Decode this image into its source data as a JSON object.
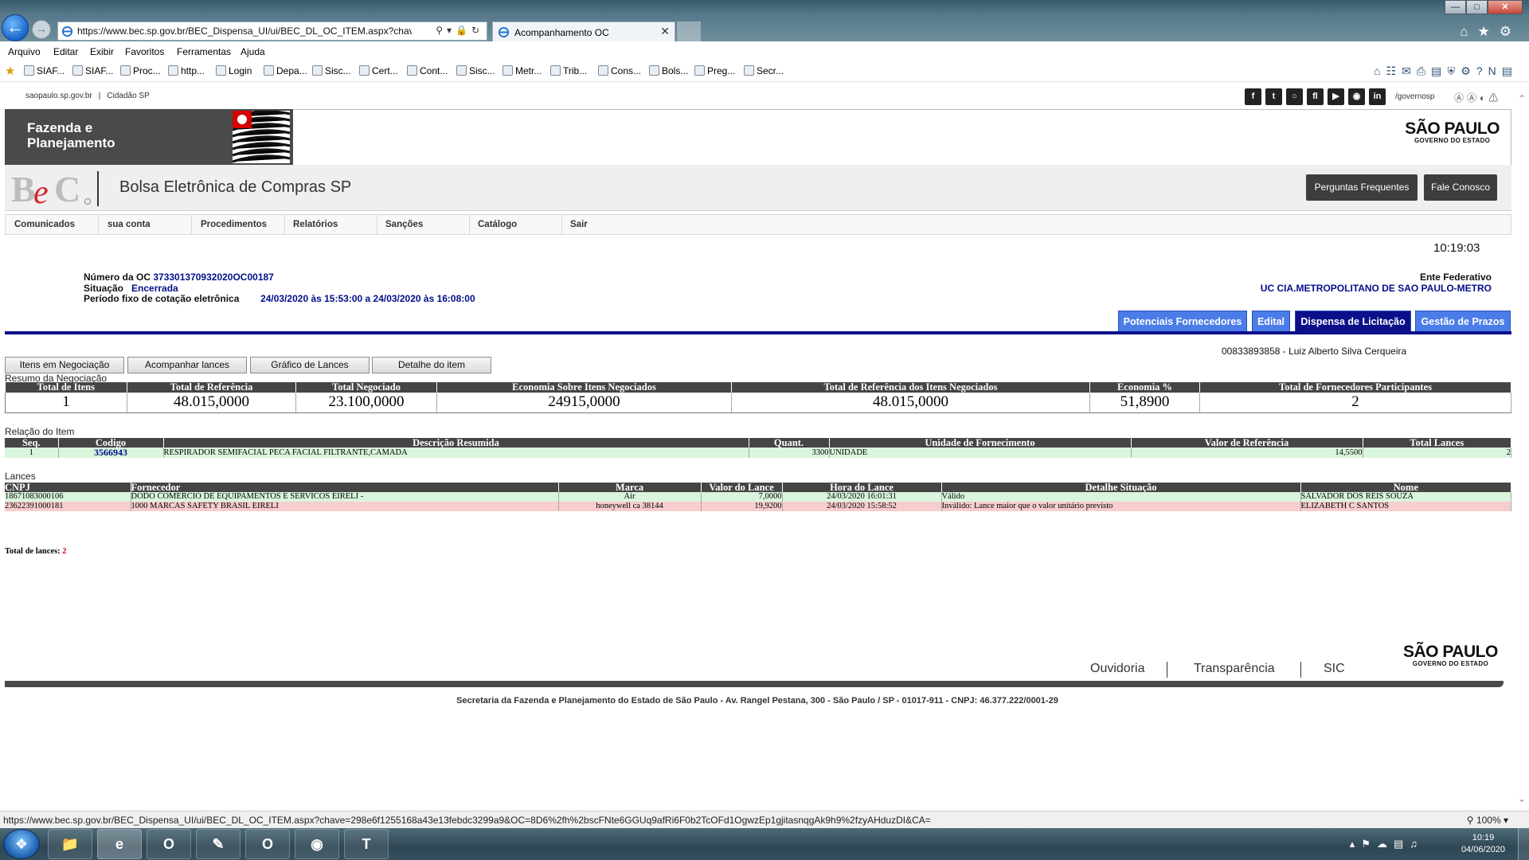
{
  "browser": {
    "url": "https://www.bec.sp.gov.br/BEC_Dispensa_UI/ui/BEC_DL_OC_ITEM.aspx?chave=298e6",
    "tab_title": "Acompanhamento OC",
    "menu": [
      "Arquivo",
      "Editar",
      "Exibir",
      "Favoritos",
      "Ferramentas",
      "Ajuda"
    ],
    "favorites": [
      "SIAF...",
      "SIAF...",
      "Proc...",
      "http...",
      "Login",
      "Depa...",
      "Sisc...",
      "Cert...",
      "Cont...",
      "Sisc...",
      "Metr...",
      "Trib...",
      "Cons...",
      "Bols...",
      "Preg...",
      "Secr..."
    ],
    "status_url": "https://www.bec.sp.gov.br/BEC_Dispensa_UI/ui/BEC_DL_OC_ITEM.aspx?chave=298e6f1255168a43e13febdc3299a9&OC=8D6%2fh%2bscFNte6GGUq9afRi6F0b2TcOFd1OgwzEp1gjitasnqgAk9h9%2fzyAHduzDI&CA=",
    "zoom": "100%"
  },
  "portal": {
    "link1": "saopaulo.sp.gov.br",
    "link2": "Cidadão SP",
    "social_icons": [
      "facebook-icon",
      "twitter-icon",
      "instagram-icon",
      "flickr-icon",
      "youtube-icon",
      "issuu-icon",
      "linkedin-icon"
    ],
    "social_handle": "/governosp",
    "dept": "Fazenda e Planejamento",
    "sp_logo_big": "SÃO PAULO",
    "sp_logo_small": "GOVERNO DO ESTADO"
  },
  "bec": {
    "title": "Bolsa Eletrônica de Compras SP",
    "btn_faq": "Perguntas Frequentes",
    "btn_contact": "Fale Conosco",
    "nav": [
      "Comunicados",
      "sua conta",
      "Procedimentos",
      "Relatórios",
      "Sanções",
      "Catálogo",
      "Sair"
    ],
    "clock": "10:19:03"
  },
  "oc": {
    "numero_label": "Número da OC",
    "numero": "373301370932020OC00187",
    "situacao_label": "Situação",
    "situacao": "Encerrada",
    "periodo_label": "Período fixo de cotação eletrônica",
    "periodo": "24/03/2020 às 15:53:00 a 24/03/2020 às 16:08:00",
    "ente_label": "Ente Federativo",
    "uc": "UC CIA.METROPOLITANO DE SAO PAULO-METRO"
  },
  "tabs": [
    "Potenciais Fornecedores",
    "Edital",
    "Dispensa de Licitação",
    "Gestão de Prazos"
  ],
  "actions": [
    "Itens em Negociação",
    "Acompanhar lances",
    "Gráfico de Lances",
    "Detalhe do item"
  ],
  "user": "00833893858 - Luiz Alberto Silva Cerqueira",
  "resumo": {
    "label": "Resumo da Negociação",
    "headers": [
      "Total de Itens",
      "Total de Referência",
      "Total Negociado",
      "Economia Sobre Itens Negociados",
      "Total de Referência dos Itens Negociados",
      "Economia %",
      "Total de Fornecedores Participantes"
    ],
    "values": [
      "1",
      "48.015,0000",
      "23.100,0000",
      "24915,0000",
      "48.015,0000",
      "51,8900",
      "2"
    ]
  },
  "item": {
    "label": "Relação do Item",
    "headers": [
      "Seq.",
      "Codigo",
      "Descrição Resumida",
      "Quant.",
      "Unidade de Fornecimento",
      "Valor de Referência",
      "Total Lances"
    ],
    "row": [
      "1",
      "3566943",
      "RESPIRADOR SEMIFACIAL PECA FACIAL FILTRANTE,CAMADA",
      "3300",
      "UNIDADE",
      "14,5500",
      "2"
    ]
  },
  "lances": {
    "label": "Lances",
    "headers": [
      "CNPJ",
      "Fornecedor",
      "Marca",
      "Valor do Lance",
      "Hora do Lance",
      "Detalhe Situação",
      "Nome"
    ],
    "rows": [
      [
        "18671083000106",
        "DODO COMERCIO DE EQUIPAMENTOS E SERVICOS EIRELI -",
        "Air",
        "7,0000",
        "24/03/2020 16:01:31",
        "Válido",
        "SALVADOR DOS REIS SOUZA"
      ],
      [
        "23622391000181",
        "1000 MARCAS SAFETY BRASIL EIRELI",
        "honeywell ca 38144",
        "19,9200",
        "24/03/2020 15:58:52",
        "Inválido: Lance maior que o valor unitário previsto",
        "ELIZABETH C SANTOS"
      ]
    ],
    "total_label": "Total de lances:",
    "total": "2"
  },
  "footer": {
    "links": [
      "Ouvidoria",
      "Transparência",
      "SIC"
    ],
    "address": "Secretaria da Fazenda e Planejamento do Estado de São Paulo - Av. Rangel Pestana, 300 - São Paulo / SP - 01017-911 - CNPJ: 46.377.222/0001-29"
  },
  "taskbar": {
    "time": "10:19",
    "date": "04/06/2020"
  },
  "colors": {
    "accent_blue": "#0c0f8a",
    "tab_blue": "#4b7ce8",
    "valid_row": "#d9f5dc",
    "invalid_row": "#f7cdcd"
  }
}
